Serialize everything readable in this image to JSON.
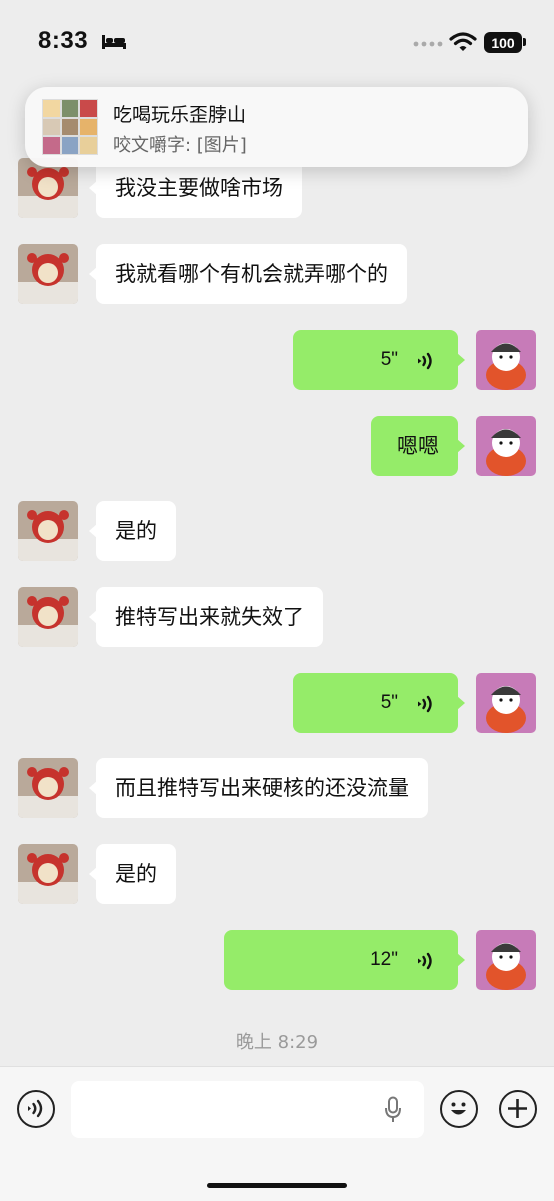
{
  "status_bar": {
    "time": "8:33",
    "battery": "100"
  },
  "notification": {
    "title": "吃喝玩乐歪脖山",
    "preview": "咬文嚼字: [图片]"
  },
  "messages": [
    {
      "dir": "in",
      "type": "text",
      "text": "我没主要做啥市场"
    },
    {
      "dir": "in",
      "type": "text",
      "text": "我就看哪个有机会就弄哪个的"
    },
    {
      "dir": "out",
      "type": "voice",
      "duration": "5\""
    },
    {
      "dir": "out",
      "type": "text",
      "text": "嗯嗯"
    },
    {
      "dir": "in",
      "type": "text",
      "text": "是的"
    },
    {
      "dir": "in",
      "type": "text",
      "text": "推特写出来就失效了"
    },
    {
      "dir": "out",
      "type": "voice",
      "duration": "5\""
    },
    {
      "dir": "in",
      "type": "text",
      "text": "而且推特写出来硬核的还没流量"
    },
    {
      "dir": "in",
      "type": "text",
      "text": "是的"
    },
    {
      "dir": "out",
      "type": "voice",
      "duration": "12\""
    }
  ],
  "timestamp": "晚上 8:29",
  "input_bar": {
    "value": ""
  },
  "icons": {
    "voice_toggle": "voice-mode-icon",
    "mic": "microphone-icon",
    "emoji": "emoji-icon",
    "more": "plus-icon",
    "voice_msg": "voice-wave-icon"
  },
  "colors": {
    "bubble_out": "#95ec69",
    "bubble_in": "#ffffff",
    "background": "#ededed"
  }
}
